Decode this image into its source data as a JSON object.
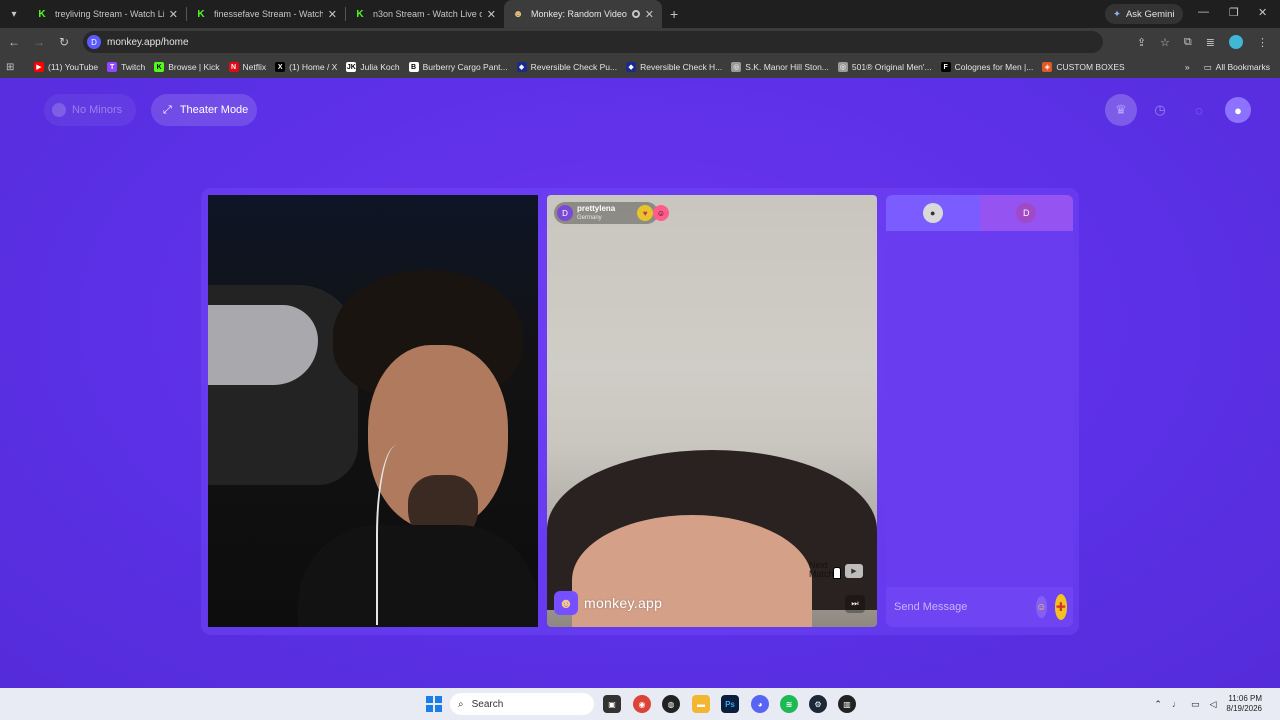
{
  "browser": {
    "tabs": [
      {
        "title": "treyliving Stream - Watch Live o",
        "icon": "kick-icon",
        "active": false
      },
      {
        "title": "finessefave Stream - Watch Live",
        "icon": "kick-icon",
        "active": false
      },
      {
        "title": "n3on Stream - Watch Live on Ki",
        "icon": "kick-icon",
        "active": false
      },
      {
        "title": "Monkey: Random Video Ch",
        "icon": "monkey-icon",
        "active": true
      }
    ],
    "new_tab_label": "+",
    "ask_gemini": "Ask Gemini",
    "url": "monkey.app/home",
    "site_badge": "D",
    "bookmarks": [
      {
        "label": "(11) YouTube",
        "icon": "youtube-icon",
        "color": "#ff0000",
        "glyph": "▶"
      },
      {
        "label": "Twitch",
        "icon": "twitch-icon",
        "color": "#9146ff",
        "glyph": "T"
      },
      {
        "label": "Browse | Kick",
        "icon": "kick-icon",
        "color": "#53fc18",
        "glyph": "K"
      },
      {
        "label": "Netflix",
        "icon": "netflix-icon",
        "color": "#e50914",
        "glyph": "N"
      },
      {
        "label": "(1) Home / X",
        "icon": "x-icon",
        "color": "#000000",
        "glyph": "X"
      },
      {
        "label": "Julia Koch",
        "icon": "jk-icon",
        "color": "#ffffff",
        "glyph": "JK"
      },
      {
        "label": "Burberry Cargo Pant...",
        "icon": "burberry-icon",
        "color": "#ffffff",
        "glyph": "B"
      },
      {
        "label": "Reversible Check Pu...",
        "icon": "tag-icon",
        "color": "#1a2b8c",
        "glyph": "◆"
      },
      {
        "label": "Reversible Check H...",
        "icon": "tag-icon",
        "color": "#1a2b8c",
        "glyph": "◆"
      },
      {
        "label": "S.K. Manor Hill Ston...",
        "icon": "globe-icon",
        "color": "#999999",
        "glyph": "◎"
      },
      {
        "label": "501® Original Men'...",
        "icon": "globe-icon",
        "color": "#999999",
        "glyph": "◎"
      },
      {
        "label": "Colognes for Men |...",
        "icon": "f-icon",
        "color": "#000000",
        "glyph": "F"
      },
      {
        "label": "CUSTOM BOXES",
        "icon": "box-icon",
        "color": "#e25822",
        "glyph": "◈"
      }
    ],
    "all_bookmarks": "All Bookmarks"
  },
  "page": {
    "no_minors": "No Minors",
    "theater_mode": "Theater Mode",
    "remote_user": {
      "avatar_letter": "D",
      "name": "prettylena",
      "country": "Germany"
    },
    "brand": "monkey.app",
    "next_match": "Next Match",
    "chat": {
      "tab2_letter": "D",
      "placeholder": "Send Message"
    }
  },
  "taskbar": {
    "search": "Search",
    "time": "11:06 PM",
    "date": "8/19/2026"
  }
}
